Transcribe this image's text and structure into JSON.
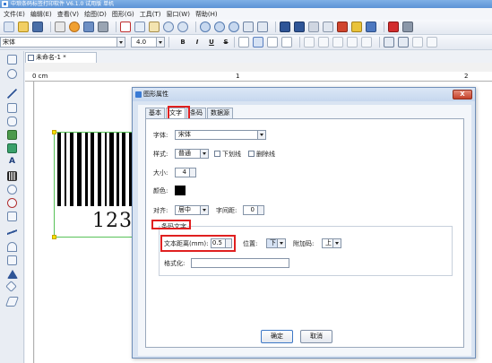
{
  "app": {
    "title": "中琅条码标签打印软件 V6.1.0 试用版 单机"
  },
  "menu": [
    "文件(E)",
    "编辑(E)",
    "查看(V)",
    "绘图(D)",
    "图形(G)",
    "工具(T)",
    "窗口(W)",
    "帮助(H)"
  ],
  "toolbar2": {
    "font_name": "宋体",
    "font_size": "4.0",
    "bold": "B",
    "italic": "I",
    "underline": "U",
    "strike": "S"
  },
  "document": {
    "tab_title": "未命名-1 *",
    "ruler_unit": "0 cm",
    "ruler_mark_1": "1",
    "ruler_mark_2": "2"
  },
  "barcode": {
    "human_readable": "123"
  },
  "dialog": {
    "title": "图形属性",
    "close_label": "X",
    "tabs": [
      "基本",
      "文字",
      "条码",
      "数据源"
    ],
    "active_tab": "文字",
    "font_label": "字体:",
    "font_value": "宋体",
    "style_label": "样式:",
    "style_value": "普通",
    "underline_label": "下划线",
    "strike_label": "删除线",
    "size_label": "大小:",
    "size_value": "4",
    "color_label": "颜色:",
    "color_value": "#000000",
    "align_label": "对齐:",
    "align_value": "居中",
    "spacing_label": "字间距:",
    "spacing_value": "0",
    "group_title": "条码文字",
    "text_distance_label": "文本距离(mm):",
    "text_distance_value": "0.5",
    "position_label": "位置:",
    "position_value": "下",
    "addon_label": "附加码:",
    "addon_value": "上",
    "format_label": "格式化:",
    "format_value": "",
    "ok_label": "确定",
    "cancel_label": "取消"
  },
  "icons": [
    "app-icon",
    "new-file-icon",
    "open-folder-icon",
    "save-icon",
    "print-icon",
    "cut-icon",
    "copy-icon",
    "paste-icon",
    "undo-icon",
    "redo-icon",
    "zoom-in-icon",
    "zoom-out-icon",
    "pointer-icon",
    "text-icon",
    "rectangle-icon",
    "ellipse-icon",
    "line-icon",
    "barcode-icon",
    "image-icon",
    "close-icon"
  ]
}
